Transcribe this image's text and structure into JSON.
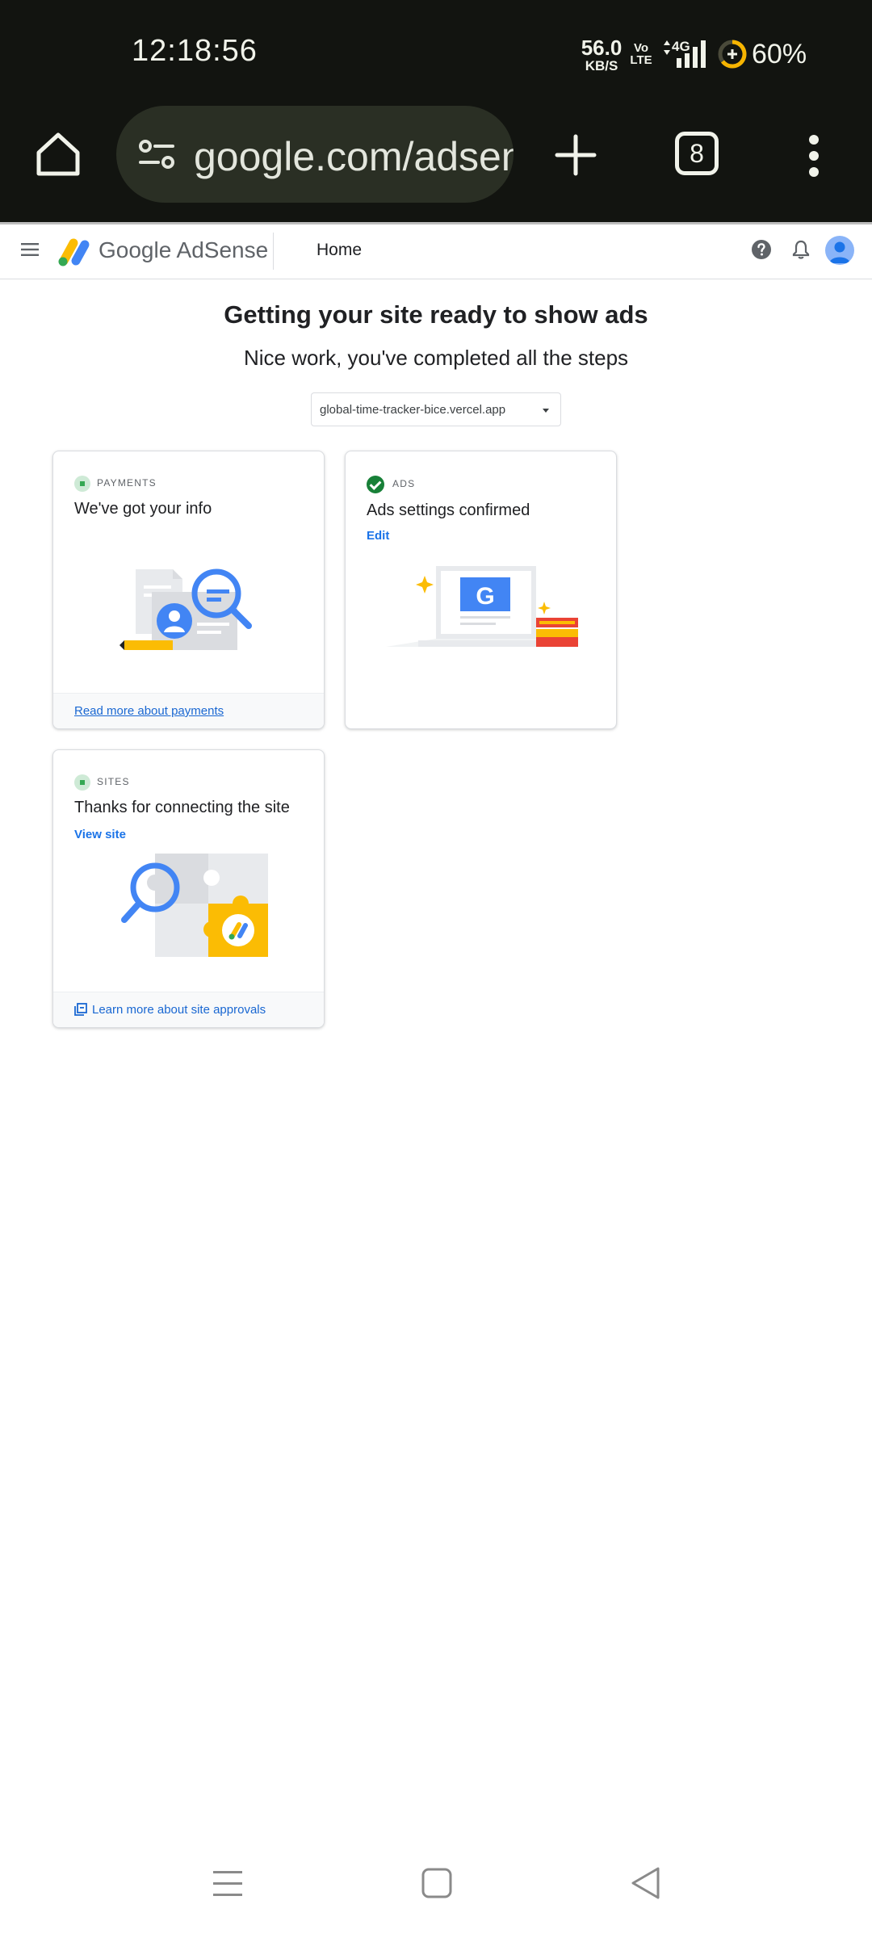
{
  "status_bar": {
    "time": "12:18:56",
    "net_speed_value": "56.0",
    "net_speed_unit": "KB/S",
    "volte_top": "Vo",
    "volte_bottom": "LTE",
    "network_type": "4G",
    "battery_percent": "60%"
  },
  "browser": {
    "url": "google.com/adsense",
    "tab_count": "8"
  },
  "header": {
    "brand_google": "Google",
    "brand_product": "AdSense",
    "nav_home": "Home"
  },
  "main": {
    "title": "Getting your site ready to show ads",
    "subtitle": "Nice work, you've completed all the steps",
    "site_selector_value": "global-time-tracker-bice.vercel.app"
  },
  "cards": {
    "payments": {
      "tag": "PAYMENTS",
      "heading": "We've got your info",
      "footer_link": "Read more about payments"
    },
    "ads": {
      "tag": "ADS",
      "heading": "Ads settings confirmed",
      "link": "Edit",
      "illustration_letter": "G"
    },
    "sites": {
      "tag": "SITES",
      "heading": "Thanks for connecting the site",
      "link": "View site",
      "footer_link": "Learn more about site approvals"
    }
  },
  "colors": {
    "link_blue": "#1a73e8",
    "success_green": "#188038",
    "chrome_bg": "#121410",
    "google_blue": "#4285f4",
    "google_yellow": "#fbbc04"
  }
}
